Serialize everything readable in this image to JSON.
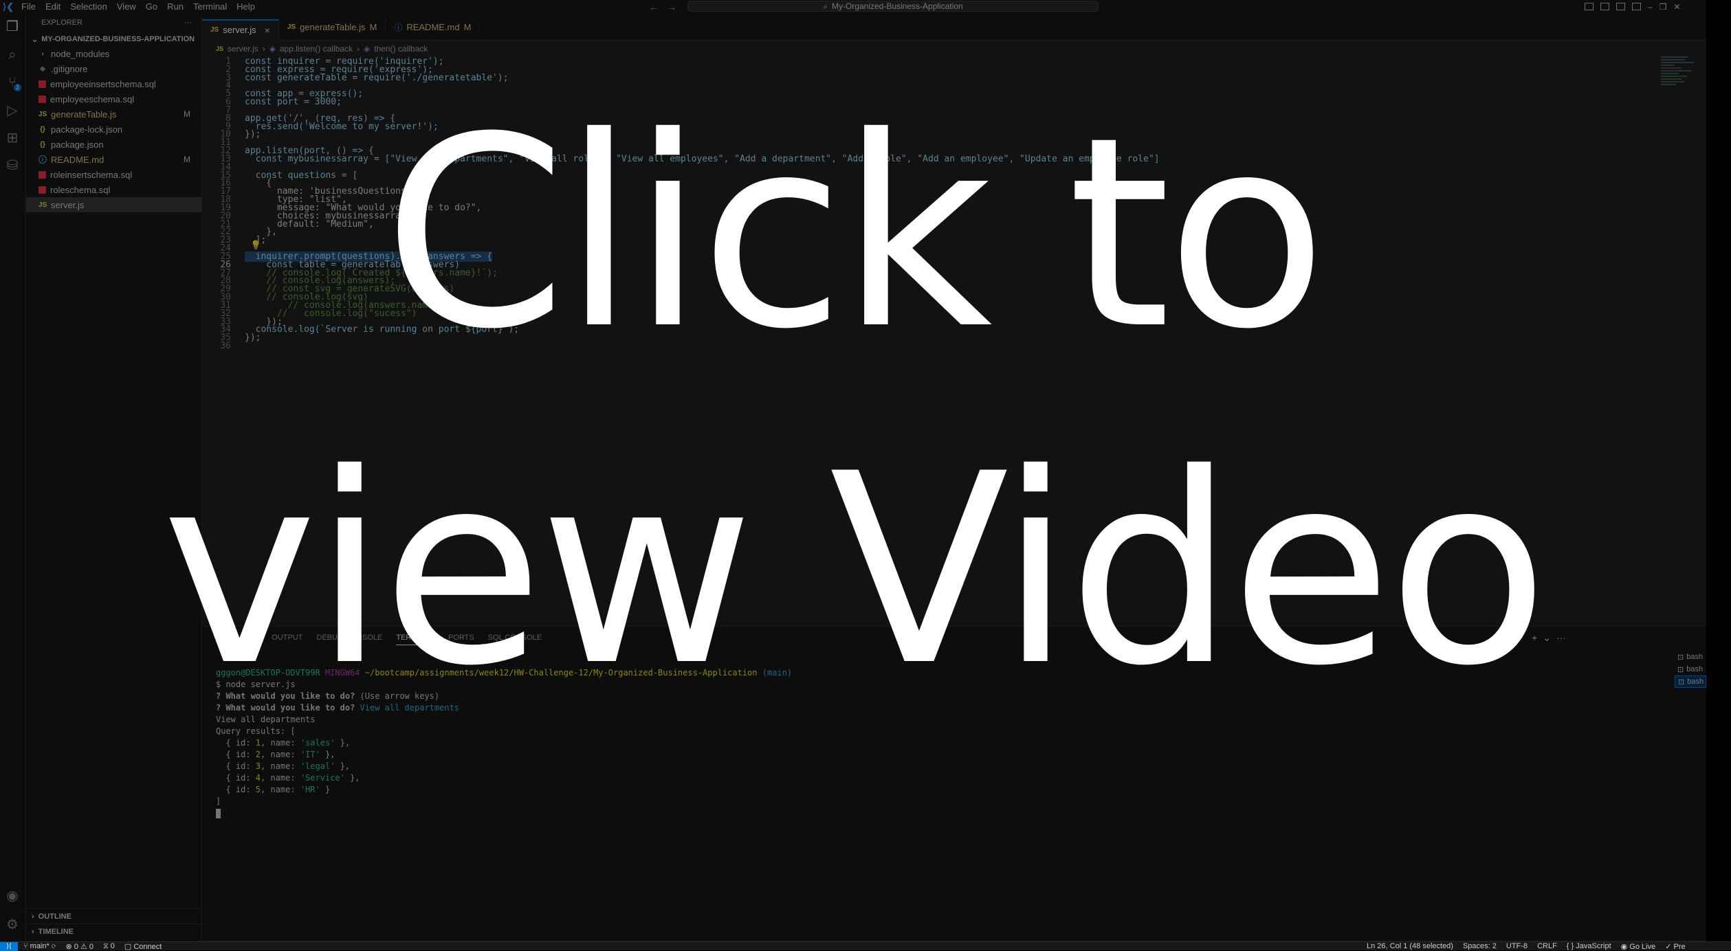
{
  "window": {
    "logo": "⟩❮",
    "menu": [
      "File",
      "Edit",
      "Selection",
      "View",
      "Go",
      "Run",
      "Terminal",
      "Help"
    ],
    "command_center": "My-Organized-Business-Application"
  },
  "activity": {
    "icons": [
      "explorer-icon",
      "search-icon",
      "source-control-icon",
      "run-debug-icon",
      "extensions-icon",
      "database-icon",
      "account-icon",
      "settings-icon"
    ],
    "badge": "2"
  },
  "sidebar": {
    "title": "EXPLORER",
    "more": "···",
    "folder": "MY-ORGANIZED-BUSINESS-APPLICATION",
    "files": [
      {
        "name": "node_modules",
        "icon": "chevron-right",
        "status": ""
      },
      {
        "name": ".gitignore",
        "icon": "git",
        "status": ""
      },
      {
        "name": "employeeinsertschema.sql",
        "icon": "sql",
        "status": ""
      },
      {
        "name": "employeeschema.sql",
        "icon": "sql",
        "status": ""
      },
      {
        "name": "generateTable.js",
        "icon": "js",
        "status": "M"
      },
      {
        "name": "package-lock.json",
        "icon": "json",
        "status": ""
      },
      {
        "name": "package.json",
        "icon": "json",
        "status": ""
      },
      {
        "name": "README.md",
        "icon": "info",
        "status": "M"
      },
      {
        "name": "roleinsertschema.sql",
        "icon": "sql",
        "status": ""
      },
      {
        "name": "roleschema.sql",
        "icon": "sql",
        "status": ""
      },
      {
        "name": "server.js",
        "icon": "js",
        "status": ""
      }
    ],
    "outline": "OUTLINE",
    "timeline": "TIMELINE"
  },
  "tabs": [
    {
      "name": "server.js",
      "status": "",
      "close": "×"
    },
    {
      "name": "generateTable.js",
      "status": "M",
      "close": ""
    },
    {
      "name": "README.md",
      "status": "M",
      "close": ""
    }
  ],
  "breadcrumb": {
    "file": "server.js",
    "part1": "app.listen() callback",
    "part2": "then() callback"
  },
  "editor": {
    "cursor_line": 26,
    "lines": [
      "const inquirer = require('inquirer');",
      "const express = require('express');",
      "const generateTable = require('./generatetable');",
      "",
      "const app = express();",
      "const port = 3000;",
      "",
      "app.get('/', (req, res) => {",
      "  res.send('Welcome to my server!');",
      "});",
      "",
      "app.listen(port, () => {",
      "  const mybusinessarray = [\"View all departments\", \"View all roles\", \"View all employees\", \"Add a department\", \"Add a role\", \"Add an employee\", \"Update an employee role\"]",
      "",
      "  const questions = [",
      "    {",
      "      name: 'businessQuestions',",
      "      type: \"list\",",
      "      message: \"What would you like to do?\",",
      "      choices: mybusinessarray,",
      "      default: \"Medium\",",
      "    },",
      "  ];",
      "",
      "  inquirer.prompt(questions).then(answers => {",
      "    const table = generateTable(answers)",
      "    // console.log(`Created ${answers.name}!`);",
      "    // console.log(answers);",
      "    // const svg = generateSVG(answers)",
      "    // console.log(svg)",
      "        // console.log(answers.name);",
      "      //   console.log(\"sucess\")",
      "    });",
      "  console.log(`Server is running on port ${port}`);",
      "});",
      ""
    ]
  },
  "panel": {
    "tabs": [
      "PROBLEMS",
      "OUTPUT",
      "DEBUG CONSOLE",
      "TERMINAL",
      "PORTS",
      "SQL CONSOLE"
    ],
    "active_tab": "TERMINAL",
    "terminal": {
      "user": "gggon@DESKTOP-ODVT99R",
      "shell": "MINGW64",
      "path": "~/bootcamp/assignments/week12/HW-Challenge-12/My-Organized-Business-Application",
      "branch": "(main)",
      "cmd": "$ node server.js",
      "q1": "? What would you like to do?",
      "q1_hint": "(Use arrow keys)",
      "q2": "? What would you like to do?",
      "q2_answer": "View all departments",
      "echo": "View all departments",
      "results_head": "Query results: [",
      "rows": [
        {
          "id": "1",
          "name": "'sales'"
        },
        {
          "id": "2",
          "name": "'IT'"
        },
        {
          "id": "3",
          "name": "'legal'"
        },
        {
          "id": "4",
          "name": "'Service'"
        },
        {
          "id": "5",
          "name": "'HR'"
        }
      ],
      "close": "]"
    },
    "terminal_list": [
      "bash",
      "bash",
      "bash"
    ]
  },
  "status": {
    "branch": "main*",
    "errors": "0",
    "warnings": "0",
    "ports": "0",
    "connect": "Connect",
    "position": "Ln 26, Col 1 (48 selected)",
    "spaces": "Spaces: 2",
    "encoding": "UTF-8",
    "eol": "CRLF",
    "language": "JavaScript",
    "golive": "Go Live",
    "prettier": "Pre"
  },
  "overlay": {
    "line1": "Click to",
    "line2": "view Video"
  }
}
